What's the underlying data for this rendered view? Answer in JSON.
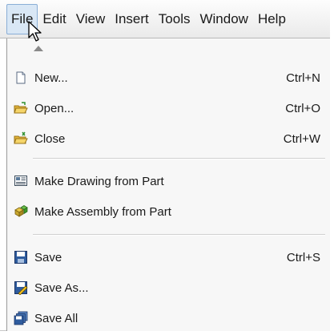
{
  "menubar": {
    "items": [
      "File",
      "Edit",
      "View",
      "Insert",
      "Tools",
      "Window",
      "Help"
    ]
  },
  "file_menu": {
    "items": [
      {
        "label": "New...",
        "shortcut": "Ctrl+N",
        "icon": "new-document-icon"
      },
      {
        "label": "Open...",
        "shortcut": "Ctrl+O",
        "icon": "open-folder-icon"
      },
      {
        "label": "Close",
        "shortcut": "Ctrl+W",
        "icon": "close-folder-icon"
      },
      {
        "label": "Make Drawing from Part",
        "shortcut": "",
        "icon": "drawing-icon"
      },
      {
        "label": "Make Assembly from Part",
        "shortcut": "",
        "icon": "assembly-icon"
      },
      {
        "label": "Save",
        "shortcut": "Ctrl+S",
        "icon": "save-icon"
      },
      {
        "label": "Save As...",
        "shortcut": "",
        "icon": "save-as-icon"
      },
      {
        "label": "Save All",
        "shortcut": "",
        "icon": "save-all-icon"
      }
    ]
  }
}
